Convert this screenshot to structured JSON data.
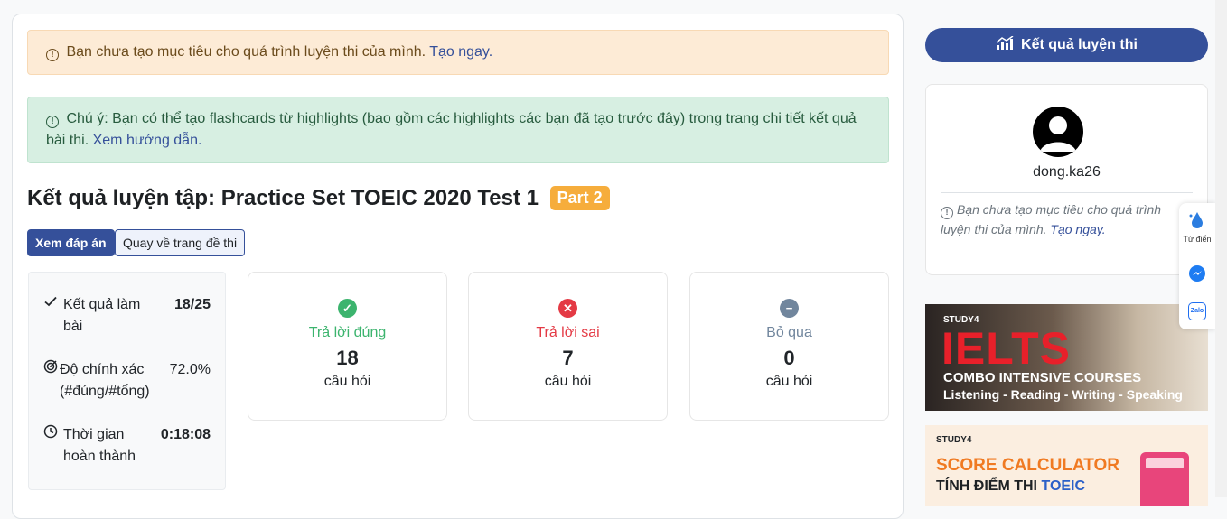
{
  "alerts": {
    "goal_text": "Bạn chưa tạo mục tiêu cho quá trình luyện thi của mình.",
    "goal_link": "Tạo ngay.",
    "note_text": "Chú ý: Bạn có thể tạo flashcards từ highlights (bao gồm các highlights các bạn đã tạo trước đây) trong trang chi tiết kết quả bài thi.",
    "note_link": "Xem hướng dẫn."
  },
  "result": {
    "title": "Kết quả luyện tập: Practice Set TOEIC 2020 Test 1",
    "part_badge": "Part 2",
    "view_answers_button": "Xem đáp án",
    "back_button": "Quay về trang đề thi"
  },
  "summary": {
    "score_label": "Kết quả làm bài",
    "score_value": "18/25",
    "accuracy_label": "Độ chính xác (#đúng/#tổng)",
    "accuracy_value": "72.0%",
    "time_label": "Thời gian hoàn thành",
    "time_value": "0:18:08"
  },
  "stats": [
    {
      "label": "Trả lời đúng",
      "count": "18",
      "unit": "câu hỏi",
      "icon": "check-circle-icon",
      "color": "#3cb46e"
    },
    {
      "label": "Trả lời sai",
      "count": "7",
      "unit": "câu hỏi",
      "icon": "x-circle-icon",
      "color": "#e43a45"
    },
    {
      "label": "Bỏ qua",
      "count": "0",
      "unit": "câu hỏi",
      "icon": "minus-circle-icon",
      "color": "#71869d"
    }
  ],
  "sidebar": {
    "results_button": "Kết quả luyện thi",
    "username": "dong.ka26",
    "goal_note": "Bạn chưa tạo mục tiêu cho quá trình luyện thi của mình.",
    "goal_link": "Tạo ngay."
  },
  "banners": {
    "ielts_brand": "STUDY4",
    "ielts_title": "IELTS",
    "ielts_subtitle": "COMBO INTENSIVE COURSES",
    "ielts_skills": "Listening - Reading - Writing - Speaking",
    "score_brand": "STUDY4",
    "score_title": "SCORE CALCULATOR",
    "score_subtitle_prefix": "TÍNH ĐIỂM THI",
    "score_subtitle_highlight": "TOEIC"
  },
  "floating": {
    "dictionary_label": "Từ điển",
    "zalo_label": "Zalo"
  },
  "colors": {
    "primary": "#35509a",
    "badge": "#f6ad3c",
    "correct": "#3cb46e",
    "wrong": "#e43a45",
    "skipped": "#71869d"
  }
}
